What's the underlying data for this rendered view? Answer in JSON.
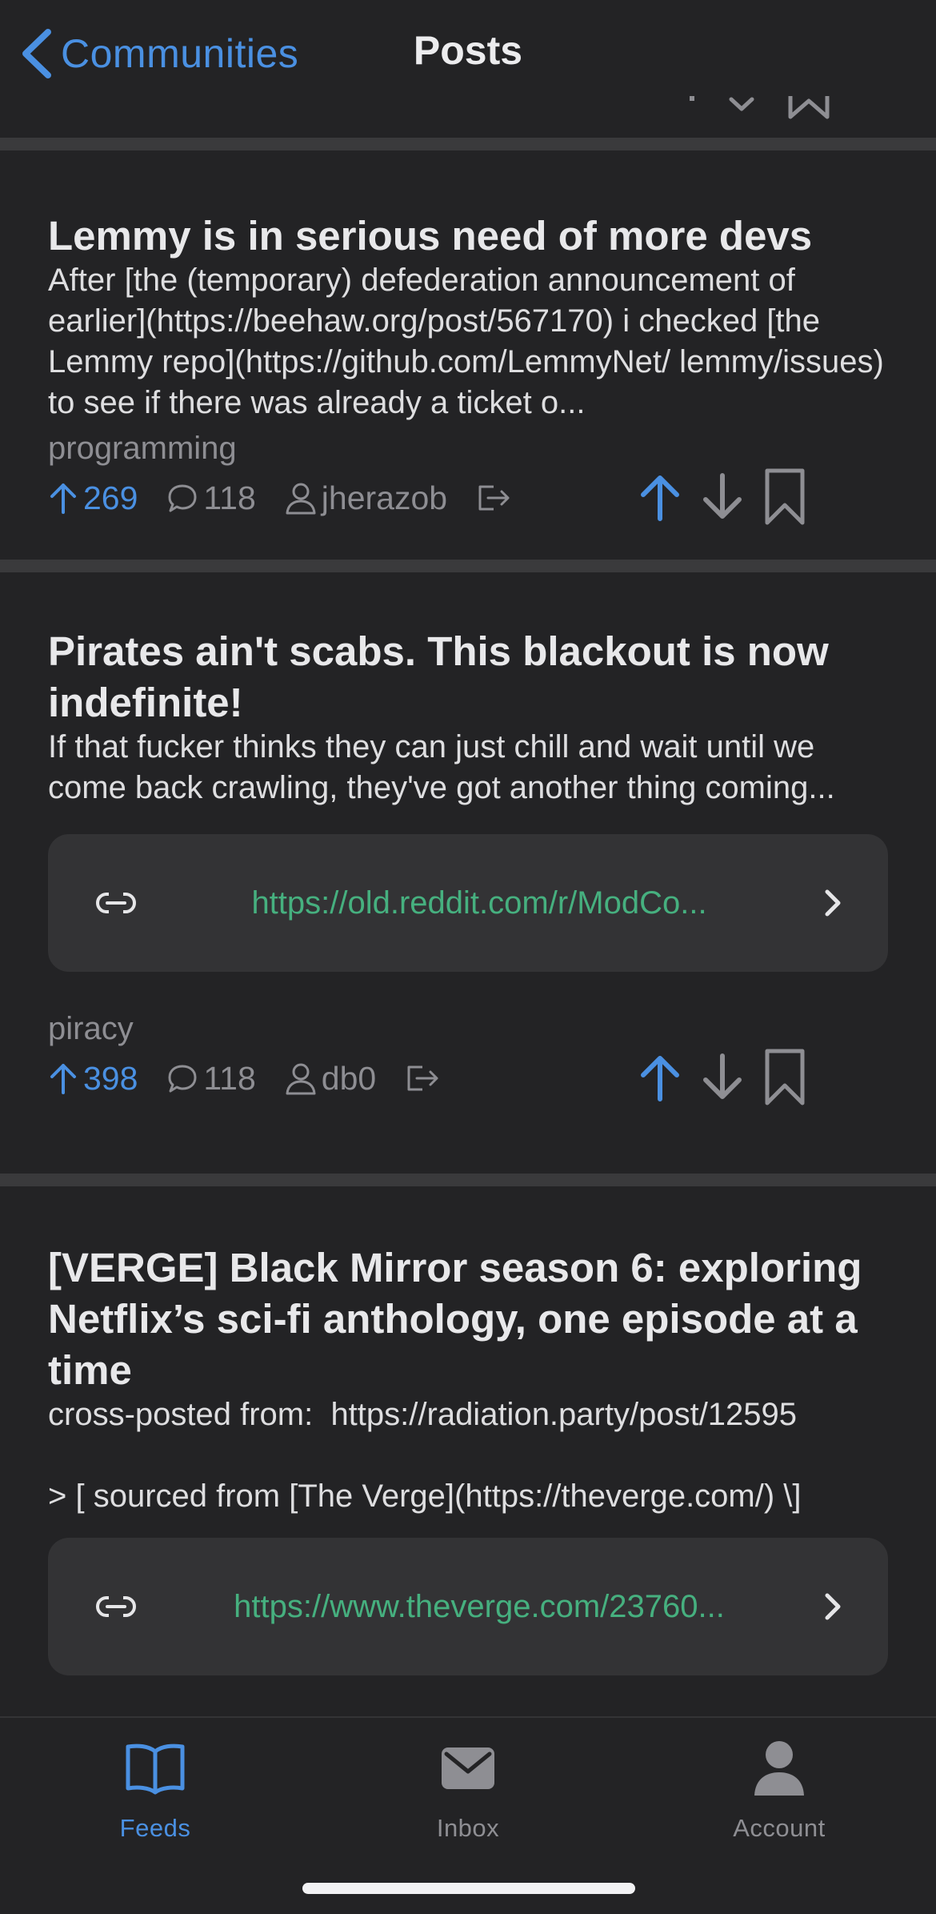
{
  "header": {
    "back_label": "Communities",
    "title": "Posts"
  },
  "posts": [
    {
      "title": "Lemmy is in serious need of more devs",
      "body": "After [the (temporary) defederation announcement of earlier](https://beehaw.org/post/567170) i checked [the Lemmy repo](https://github.com/LemmyNet/ lemmy/issues) to see if there was already a ticket o...",
      "community": "programming",
      "score": "269",
      "comments": "118",
      "author": "jherazob"
    },
    {
      "title": "Pirates ain't scabs. This blackout is now indefinite!",
      "body": "If that fucker thinks they can just chill and wait until we come back crawling, they've got another thing coming...",
      "link": "https://old.reddit.com/r/ModCo...",
      "community": "piracy",
      "score": "398",
      "comments": "118",
      "author": "db0"
    },
    {
      "title": "[VERGE] Black Mirror season 6: exploring Netflix’s sci-fi anthology, one episode at a time",
      "body": "cross-posted from:  https://radiation.party/post/12595\n\n> [ sourced from [The Verge](https://theverge.com/) \\]",
      "link": "https://www.theverge.com/23760..."
    }
  ],
  "tabs": [
    {
      "label": "Feeds",
      "icon": "book-icon",
      "active": true
    },
    {
      "label": "Inbox",
      "icon": "envelope-icon",
      "active": false
    },
    {
      "label": "Account",
      "icon": "person-icon",
      "active": false
    }
  ],
  "colors": {
    "background": "#1e1e20",
    "card": "#232325",
    "separator": "#3a3a3c",
    "accent": "#4a90e2",
    "link": "#46b07f",
    "muted": "#8e8e93"
  }
}
